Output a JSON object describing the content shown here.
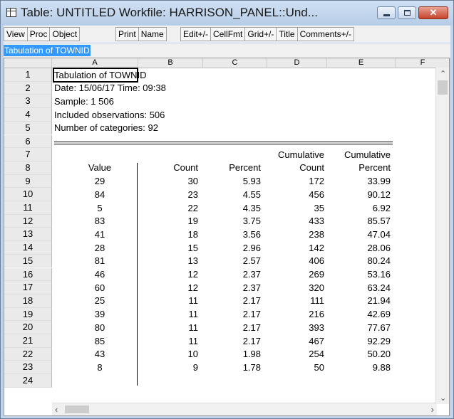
{
  "window": {
    "title": "Table: UNTITLED   Workfile: HARRISON_PANEL::Und...",
    "controls": {
      "minimize_icon": "minimize-icon",
      "maximize_icon": "maximize-icon",
      "close_icon": "close-icon"
    }
  },
  "toolbar": {
    "groups": [
      [
        "View",
        "Proc",
        "Object"
      ],
      [
        "Print",
        "Name"
      ],
      [
        "Edit+/-",
        "CellFmt",
        "Grid+/-",
        "Title",
        "Comments+/-"
      ]
    ]
  },
  "subtitle": "Tabulation of TOWNID",
  "columns": [
    "A",
    "B",
    "C",
    "D",
    "E",
    "F"
  ],
  "rows": [
    {
      "n": "1",
      "a": "Tabulation of TOWNID"
    },
    {
      "n": "2",
      "a": "Date: 15/06/17   Time: 09:38"
    },
    {
      "n": "3",
      "a": "Sample: 1 506"
    },
    {
      "n": "4",
      "a": "Included observations: 506"
    },
    {
      "n": "5",
      "a": "Number of categories: 92"
    },
    {
      "n": "6"
    },
    {
      "n": "7",
      "d": "Cumulative",
      "e": "Cumulative"
    },
    {
      "n": "8",
      "a": "Value",
      "b": "Count",
      "c": "Percent",
      "d": "Count",
      "e": "Percent"
    },
    {
      "n": "9",
      "a": "29",
      "b": "30",
      "c": "5.93",
      "d": "172",
      "e": "33.99"
    },
    {
      "n": "10",
      "a": "84",
      "b": "23",
      "c": "4.55",
      "d": "456",
      "e": "90.12"
    },
    {
      "n": "11",
      "a": "5",
      "b": "22",
      "c": "4.35",
      "d": "35",
      "e": "6.92"
    },
    {
      "n": "12",
      "a": "83",
      "b": "19",
      "c": "3.75",
      "d": "433",
      "e": "85.57"
    },
    {
      "n": "13",
      "a": "41",
      "b": "18",
      "c": "3.56",
      "d": "238",
      "e": "47.04"
    },
    {
      "n": "14",
      "a": "28",
      "b": "15",
      "c": "2.96",
      "d": "142",
      "e": "28.06"
    },
    {
      "n": "15",
      "a": "81",
      "b": "13",
      "c": "2.57",
      "d": "406",
      "e": "80.24"
    },
    {
      "n": "16",
      "a": "46",
      "b": "12",
      "c": "2.37",
      "d": "269",
      "e": "53.16"
    },
    {
      "n": "17",
      "a": "60",
      "b": "12",
      "c": "2.37",
      "d": "320",
      "e": "63.24"
    },
    {
      "n": "18",
      "a": "25",
      "b": "11",
      "c": "2.17",
      "d": "111",
      "e": "21.94"
    },
    {
      "n": "19",
      "a": "39",
      "b": "11",
      "c": "2.17",
      "d": "216",
      "e": "42.69"
    },
    {
      "n": "20",
      "a": "80",
      "b": "11",
      "c": "2.17",
      "d": "393",
      "e": "77.67"
    },
    {
      "n": "21",
      "a": "85",
      "b": "11",
      "c": "2.17",
      "d": "467",
      "e": "92.29"
    },
    {
      "n": "22",
      "a": "43",
      "b": "10",
      "c": "1.98",
      "d": "254",
      "e": "50.20"
    },
    {
      "n": "23",
      "a": "8",
      "b": "9",
      "c": "1.78",
      "d": "50",
      "e": "9.88"
    },
    {
      "n": "24"
    }
  ]
}
